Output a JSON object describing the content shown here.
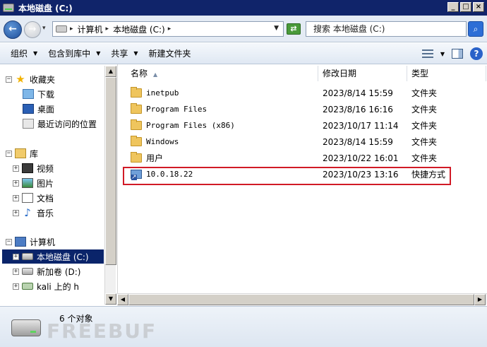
{
  "window": {
    "title": "本地磁盘 (C:)",
    "min_glyph": "_",
    "max_glyph": "□",
    "close_glyph": "×"
  },
  "address": {
    "breadcrumbs": [
      "计算机",
      "本地磁盘 (C:)"
    ],
    "search_placeholder": "搜索 本地磁盘 (C:)"
  },
  "toolbar": {
    "organize": "组织",
    "include_library": "包含到库中",
    "share": "共享",
    "new_folder": "新建文件夹"
  },
  "nav": {
    "favorites": "收藏夹",
    "downloads": "下载",
    "desktop": "桌面",
    "recent": "最近访问的位置",
    "libraries": "库",
    "videos": "视频",
    "pictures": "图片",
    "documents": "文档",
    "music": "音乐",
    "computer": "计算机",
    "local_disk": "本地磁盘 (C:)",
    "new_volume": "新加卷 (D:)",
    "network_share": "kali 上的 h"
  },
  "columns": {
    "name": "名称",
    "modified": "修改日期",
    "type": "类型"
  },
  "files": [
    {
      "name": "inetpub",
      "date": "2023/8/14 15:59",
      "type": "文件夹",
      "icon": "folder-icon"
    },
    {
      "name": "Program Files",
      "date": "2023/8/16 16:16",
      "type": "文件夹",
      "icon": "folder-icon"
    },
    {
      "name": "Program Files (x86)",
      "date": "2023/10/17 11:14",
      "type": "文件夹",
      "icon": "folder-icon"
    },
    {
      "name": "Windows",
      "date": "2023/8/14 15:59",
      "type": "文件夹",
      "icon": "folder-icon"
    },
    {
      "name": "用户",
      "date": "2023/10/22 16:01",
      "type": "文件夹",
      "icon": "folder-icon"
    },
    {
      "name": "10.0.18.22",
      "date": "2023/10/23 13:16",
      "type": "快捷方式",
      "icon": "shortcut-icon"
    }
  ],
  "status": {
    "count": "6 个对象"
  },
  "watermark": "FREEBUF",
  "colors": {
    "titlebar": "#10246a",
    "selection": "#0a246a",
    "highlight_border": "#d11a26"
  }
}
